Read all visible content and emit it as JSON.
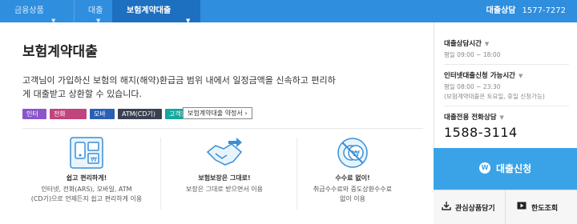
{
  "nav": {
    "breadcrumbs": [
      {
        "label": "금융상품"
      },
      {
        "label": "대출"
      },
      {
        "label": "보험계약대출"
      }
    ],
    "consult_label": "대출상담",
    "consult_phone": "1577-7272"
  },
  "main": {
    "title": "보험계약대출",
    "description": "고객님이 가입하신 보험의 해지(해약)환급금 범위 내에서 일정금액을 신속하고 편리하게 대출받고 상환할 수 있습니다.",
    "tags": [
      "인터넷",
      "전화(ARS)",
      "모바일",
      "ATM(CD기)",
      "고객창구"
    ],
    "terms_button": "보험계약대출 약정서 ›",
    "features": [
      {
        "icon": "devices-icon",
        "title": "쉽고 편리하게!",
        "desc_lines": [
          "인터넷, 전화(ARS), 모바일, ATM",
          "(CD기)으로 언제든지 쉽고 편리하게 이용"
        ]
      },
      {
        "icon": "handshake-icon",
        "title": "보험보장은 그대로!",
        "desc_lines": [
          "보장은 그대로 받으면서 이용"
        ]
      },
      {
        "icon": "no-fee-icon",
        "title": "수수료 없이!",
        "desc_lines": [
          "취급수수료와 중도상환수수료",
          "없이 이용"
        ]
      }
    ]
  },
  "sidebar": {
    "consult_time_title": "대출상담시간",
    "consult_time_value": "평일 09:00 ~ 18:00",
    "internet_time_title": "인터넷대출신청 가능시간",
    "internet_time_value": "평일 08:00 ~ 23:30",
    "internet_time_note": "(보험계약대출은 토요일, 휴일 신청가능)",
    "phone_title": "대출전용 전화상담",
    "phone_number": "1588-3114",
    "apply_button": "대출신청",
    "apply_logo": "W",
    "bottom_buttons": [
      {
        "label": "관심상품담기",
        "icon": "download-icon"
      },
      {
        "label": "한도조회",
        "icon": "play-icon"
      }
    ]
  },
  "colors": {
    "nav_bg": "#2f8ede",
    "nav_active": "#1d6fc0",
    "apply_bg": "#3aa3e8"
  }
}
